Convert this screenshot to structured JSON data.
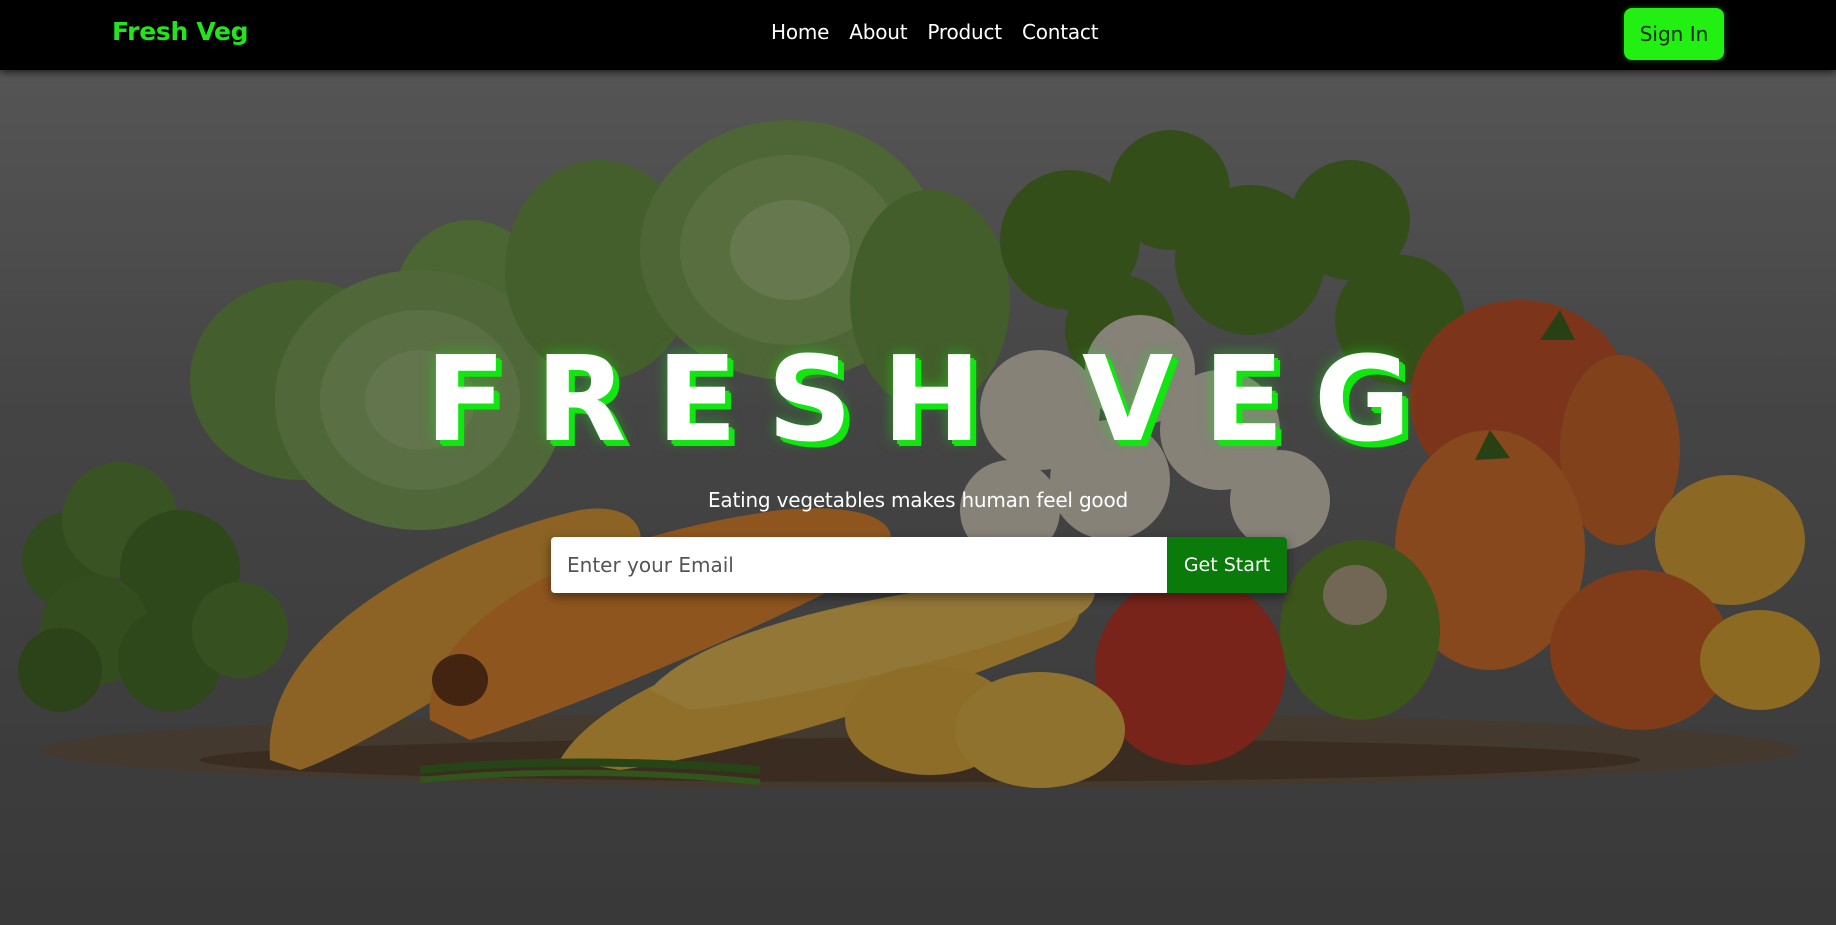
{
  "navbar": {
    "brand": "Fresh Veg",
    "links": [
      "Home",
      "About",
      "Product",
      "Contact"
    ],
    "signin_label": "Sign In"
  },
  "hero": {
    "title": "FRESH VEG",
    "subtitle": "Eating vegetables makes human feel good",
    "email_placeholder": "Enter your Email",
    "email_value": "",
    "cta_label": "Get Start",
    "background_image": "vegetables-illustration"
  },
  "colors": {
    "brand_green": "#22e61a",
    "signin_bg": "#22f012",
    "cta_bg": "#0a7a0a",
    "navbar_bg": "#000000",
    "title_glow": "#11e611"
  }
}
